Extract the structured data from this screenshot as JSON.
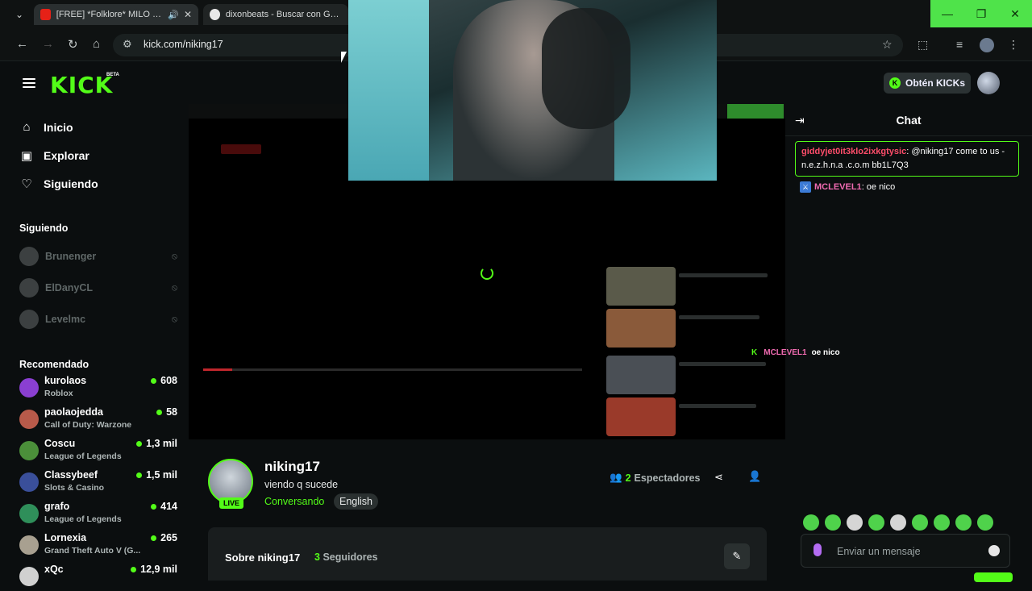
{
  "browser": {
    "tabs": [
      {
        "title": "[FREE] *Folklore* MILO J Ty..."
      },
      {
        "title": "dixonbeats - Buscar con Google"
      }
    ],
    "url": "kick.com/niking17"
  },
  "topbar": {
    "logo": "KICK",
    "beta": "BETA",
    "get_kicks": "Obtén KICKs"
  },
  "sidebar": {
    "nav": [
      {
        "label": "Inicio",
        "icon": "home-icon"
      },
      {
        "label": "Explorar",
        "icon": "explore-icon"
      },
      {
        "label": "Siguiendo",
        "icon": "heart-icon"
      }
    ],
    "following_title": "Siguiendo",
    "following": [
      {
        "name": "Brunenger"
      },
      {
        "name": "ElDanyCL"
      },
      {
        "name": "Levelmc"
      }
    ],
    "recommended_title": "Recomendado",
    "recommended": [
      {
        "name": "kurolaos",
        "category": "Roblox",
        "viewers": "608",
        "color": "#8a3fd1"
      },
      {
        "name": "paolaojedda",
        "category": "Call of Duty: Warzone",
        "viewers": "58",
        "color": "#b85a4a"
      },
      {
        "name": "Coscu",
        "category": "League of Legends",
        "viewers": "1,3 mil",
        "color": "#4b8f3a"
      },
      {
        "name": "Classybeef",
        "category": "Slots & Casino",
        "viewers": "1,5 mil",
        "color": "#3a4f9a"
      },
      {
        "name": "grafo",
        "category": "League of Legends",
        "viewers": "414",
        "color": "#2f8f5a"
      },
      {
        "name": "Lornexia",
        "category": "Grand Theft Auto V (G...",
        "viewers": "265",
        "color": "#a8a090"
      },
      {
        "name": "xQc",
        "category": "",
        "viewers": "12,9 mil",
        "color": "#d0d0d0"
      }
    ]
  },
  "chat": {
    "title": "Chat",
    "pinned": {
      "user": "giddyjet0it3klo2ixkgtysic",
      "text": ": @niking17 come to us - n.e.z.h.n.a .c.o.m bb1L7Q3"
    },
    "messages": [
      {
        "user": "MCLEVEL1",
        "text": ": oe nico"
      }
    ],
    "input_placeholder": "Enviar un mensaje"
  },
  "overlay_chat": {
    "user": "MCLEVEL1",
    "text": "oe nico"
  },
  "streamer": {
    "name": "niking17",
    "live": "LIVE",
    "stream_title": "viendo q sucede",
    "category": "Conversando",
    "tag": "English",
    "viewers_count": "2",
    "viewers_label": "Espectadores"
  },
  "about": {
    "title": "Sobre niking17",
    "followers_count": "3",
    "followers_label": "Seguidores"
  },
  "colors": {
    "accent": "#53fc18",
    "background": "#0b0e0f"
  }
}
